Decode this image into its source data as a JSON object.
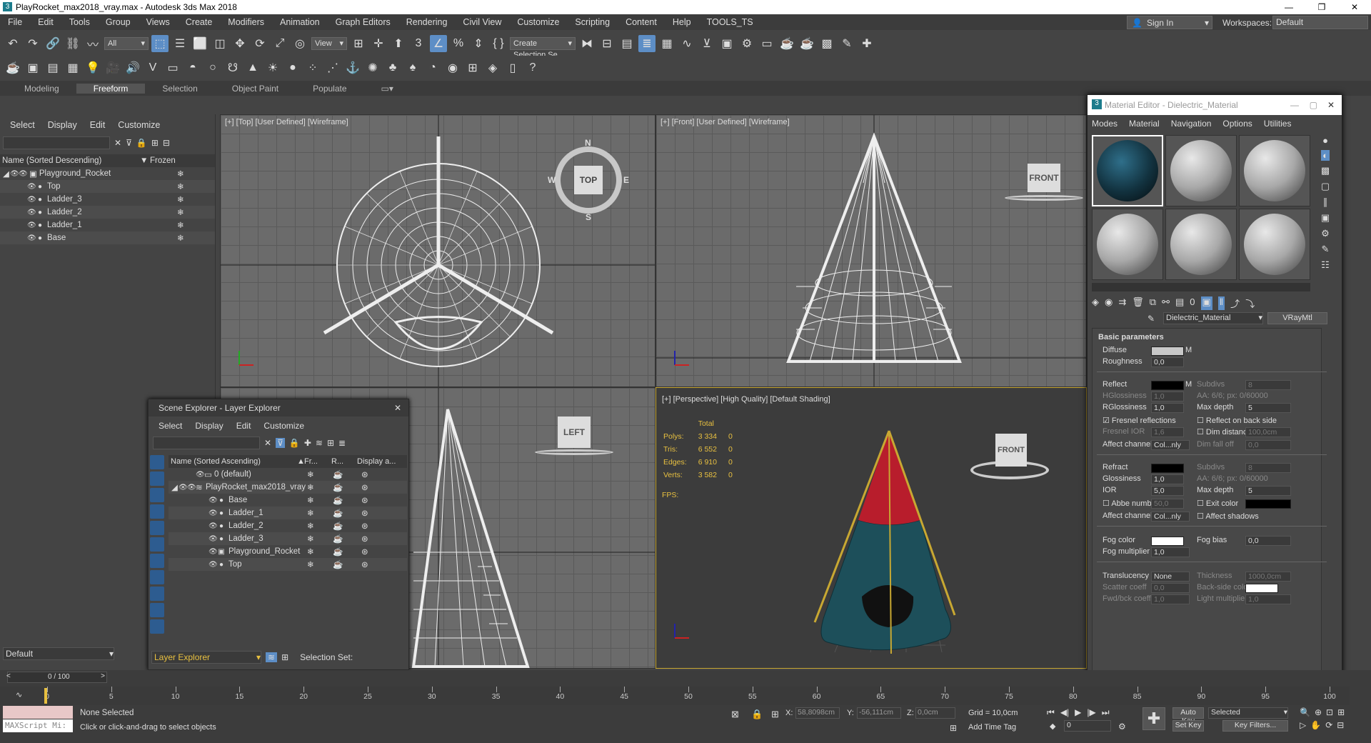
{
  "title": "PlayRocket_max2018_vray.max - Autodesk 3ds Max 2018",
  "menu": [
    "File",
    "Edit",
    "Tools",
    "Group",
    "Views",
    "Create",
    "Modifiers",
    "Animation",
    "Graph Editors",
    "Rendering",
    "Civil View",
    "Customize",
    "Scripting",
    "Content",
    "Help",
    "TOOLS_TS"
  ],
  "sign_in": "Sign In",
  "workspaces_label": "Workspaces:",
  "workspaces_value": "Default",
  "toolbar": {
    "filter": "All",
    "view": "View",
    "selection_set": "Create Selection Se"
  },
  "ribbon_tabs": [
    "Modeling",
    "Freeform",
    "Selection",
    "Object Paint",
    "Populate"
  ],
  "scene_explorer": {
    "menu": [
      "Select",
      "Display",
      "Edit",
      "Customize"
    ],
    "col_name": "Name (Sorted Descending)",
    "col_frozen": "Frozen",
    "items": [
      "Playground_Rocket",
      "Top",
      "Ladder_3",
      "Ladder_2",
      "Ladder_1",
      "Base"
    ],
    "layer_dropdown": "Default"
  },
  "viewports": {
    "top": "[+] [Top] [User Defined] [Wireframe]",
    "front": "[+] [Front] [User Defined] [Wireframe]",
    "perspective": "[+] [Perspective] [High Quality] [Default Shading]",
    "viewcube_top": "TOP",
    "viewcube_front": "FRONT",
    "viewcube_left": "LEFT",
    "compass": {
      "n": "N",
      "s": "S",
      "e": "E",
      "w": "W"
    }
  },
  "stats": {
    "header": "Total",
    "rows": [
      {
        "label": "Polys:",
        "total": "3 334",
        "sel": "0"
      },
      {
        "label": "Tris:",
        "total": "6 552",
        "sel": "0"
      },
      {
        "label": "Edges:",
        "total": "6 910",
        "sel": "0"
      },
      {
        "label": "Verts:",
        "total": "3 582",
        "sel": "0"
      }
    ],
    "fps": "FPS:"
  },
  "layer_explorer": {
    "title": "Scene Explorer - Layer Explorer",
    "menu": [
      "Select",
      "Display",
      "Edit",
      "Customize"
    ],
    "cols": [
      "Name (Sorted Ascending)",
      "Fr...",
      "R...",
      "Display a..."
    ],
    "items": [
      "0 (default)",
      "PlayRocket_max2018_vray",
      "Base",
      "Ladder_1",
      "Ladder_2",
      "Ladder_3",
      "Playground_Rocket",
      "Top"
    ],
    "footer_dropdown": "Layer Explorer",
    "selection_set": "Selection Set:"
  },
  "material_editor": {
    "title": "Material Editor - Dielectric_Material",
    "menu": [
      "Modes",
      "Material",
      "Navigation",
      "Options",
      "Utilities"
    ],
    "mat_name": "Dielectric_Material",
    "mat_type": "VRayMtl",
    "section": "Basic parameters",
    "params": {
      "diffuse": "Diffuse",
      "roughness": "Roughness",
      "roughness_val": "0,0",
      "reflect": "Reflect",
      "subdivs": "Subdivs",
      "subdivs_val": "8",
      "hglossiness": "HGlossiness",
      "hglossiness_val": "1,0",
      "aa1": "AA: 6/6; px: 0/60000",
      "rglossiness": "RGlossiness",
      "rglossiness_val": "1,0",
      "max_depth": "Max depth",
      "max_depth_val": "5",
      "fresnel": "Fresnel reflections",
      "reflect_back": "Reflect on back side",
      "fresnel_ior": "Fresnel IOR",
      "fresnel_ior_val": "1,6",
      "dim_distance": "Dim distance",
      "dim_distance_val": "100,0cm",
      "affect_channels": "Affect channels",
      "affect_val": "Col...nly",
      "dim_falloff": "Dim fall off",
      "dim_falloff_val": "0,0",
      "refract": "Refract",
      "subdivs2": "Subdivs",
      "subdivs2_val": "8",
      "glossiness": "Glossiness",
      "glossiness_val": "1,0",
      "aa2": "AA: 6/6; px: 0/60000",
      "ior": "IOR",
      "ior_val": "5,0",
      "max_depth2": "Max depth",
      "max_depth2_val": "5",
      "abbe": "Abbe number",
      "abbe_val": "50,0",
      "exit_color": "Exit color",
      "affect_channels2": "Affect channels",
      "affect_val2": "Col...nly",
      "affect_shadows": "Affect shadows",
      "fog_color": "Fog color",
      "fog_bias": "Fog bias",
      "fog_bias_val": "0,0",
      "fog_mult": "Fog multiplier",
      "fog_mult_val": "1,0",
      "translucency": "Translucency",
      "transl_val": "None",
      "thickness": "Thickness",
      "thickness_val": "1000,0cm",
      "scatter": "Scatter coeff",
      "scatter_val": "0,0",
      "backside": "Back-side color",
      "fwdbck": "Fwd/bck coeff",
      "fwdbck_val": "1,0",
      "light_mult": "Light multiplier",
      "light_mult_val": "1,0"
    }
  },
  "timeline": {
    "frame": "0 / 100",
    "ticks": [
      "0",
      "5",
      "10",
      "15",
      "20",
      "25",
      "30",
      "35",
      "40",
      "45",
      "50",
      "55",
      "60",
      "65",
      "70",
      "75",
      "80",
      "85",
      "90",
      "95",
      "100"
    ]
  },
  "status": {
    "none_selected": "None Selected",
    "prompt": "Click or click-and-drag to select objects",
    "x_label": "X:",
    "x_val": "58,8098cm",
    "y_label": "Y:",
    "y_val": "-56,111cm",
    "z_label": "Z:",
    "z_val": "0,0cm",
    "grid": "Grid = 10,0cm",
    "add_time_tag": "Add Time Tag",
    "auto_key": "Auto Key",
    "selected": "Selected",
    "set_key": "Set Key",
    "key_filters": "Key Filters...",
    "frame_val": "0",
    "maxscript": "MAXScript Mi:"
  }
}
